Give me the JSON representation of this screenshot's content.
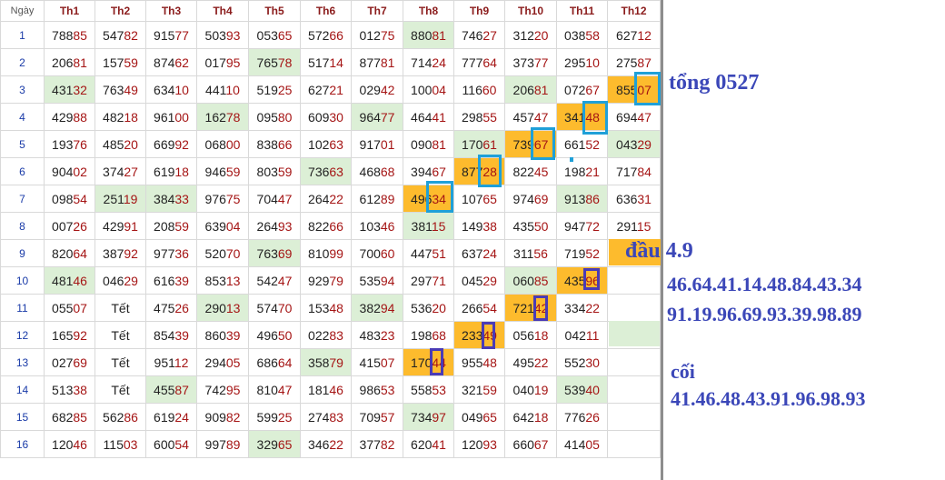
{
  "header": {
    "day_label": "Ngày",
    "months": [
      "Th1",
      "Th2",
      "Th3",
      "Th4",
      "Th5",
      "Th6",
      "Th7",
      "Th8",
      "Th9",
      "Th10",
      "Th11",
      "Th12"
    ]
  },
  "colors": {
    "highlight_green": "#dcefd6",
    "highlight_orange": "#fdbb2d",
    "box_cyan": "#1fa0d8",
    "box_purple": "#4a3bb5",
    "note_text": "#3b47b8"
  },
  "rows": [
    {
      "day": "1",
      "values": [
        "78885",
        "54782",
        "91577",
        "50393",
        "05365",
        "57266",
        "01275",
        "88081",
        "74627",
        "31220",
        "03858",
        "62712"
      ]
    },
    {
      "day": "2",
      "values": [
        "20681",
        "15759",
        "87462",
        "01795",
        "76578",
        "51714",
        "87781",
        "71424",
        "77764",
        "37377",
        "29510",
        "27587"
      ]
    },
    {
      "day": "3",
      "values": [
        "43132",
        "76349",
        "63410",
        "44110",
        "51925",
        "62721",
        "02942",
        "10004",
        "11660",
        "20681",
        "07267",
        "85507"
      ]
    },
    {
      "day": "4",
      "values": [
        "42988",
        "48218",
        "96100",
        "16278",
        "09580",
        "60930",
        "96477",
        "46441",
        "29855",
        "45747",
        "34148",
        "69447"
      ]
    },
    {
      "day": "5",
      "values": [
        "19376",
        "48520",
        "66992",
        "06800",
        "83866",
        "10263",
        "91701",
        "09081",
        "17061",
        "73967",
        "66152",
        "04329"
      ]
    },
    {
      "day": "6",
      "values": [
        "90402",
        "37427",
        "61918",
        "94659",
        "80359",
        "73663",
        "46868",
        "39467",
        "87728",
        "82245",
        "19821",
        "71784"
      ]
    },
    {
      "day": "7",
      "values": [
        "09854",
        "25119",
        "38433",
        "97675",
        "70447",
        "26422",
        "61289",
        "49634",
        "10765",
        "97469",
        "91386",
        "63631"
      ]
    },
    {
      "day": "8",
      "values": [
        "00726",
        "42991",
        "20859",
        "63904",
        "26493",
        "82266",
        "10346",
        "38115",
        "14938",
        "43550",
        "94772",
        "29115"
      ]
    },
    {
      "day": "9",
      "values": [
        "82064",
        "38792",
        "97736",
        "52070",
        "76369",
        "81099",
        "70060",
        "44751",
        "63724",
        "31156",
        "71952",
        ""
      ]
    },
    {
      "day": "10",
      "values": [
        "48146",
        "04629",
        "61639",
        "85313",
        "54247",
        "92979",
        "53594",
        "29771",
        "04529",
        "06085",
        "43596",
        ""
      ]
    },
    {
      "day": "11",
      "values": [
        "05507",
        "Tết",
        "47526",
        "29013",
        "57470",
        "15348",
        "38294",
        "53620",
        "26654",
        "72142",
        "33422",
        ""
      ]
    },
    {
      "day": "12",
      "values": [
        "16592",
        "Tết",
        "85439",
        "86039",
        "49650",
        "02283",
        "48323",
        "19868",
        "23349",
        "05618",
        "04211",
        ""
      ]
    },
    {
      "day": "13",
      "values": [
        "02769",
        "Tết",
        "95112",
        "29405",
        "68664",
        "35879",
        "41507",
        "17044",
        "95548",
        "49522",
        "55230",
        ""
      ]
    },
    {
      "day": "14",
      "values": [
        "51338",
        "Tết",
        "45587",
        "74295",
        "81047",
        "18146",
        "98653",
        "55853",
        "32159",
        "04019",
        "53940",
        ""
      ]
    },
    {
      "day": "15",
      "values": [
        "68285",
        "56286",
        "61924",
        "90982",
        "59925",
        "27483",
        "70957",
        "73497",
        "04965",
        "64218",
        "77626",
        ""
      ]
    },
    {
      "day": "16",
      "values": [
        "12046",
        "11503",
        "60054",
        "99789",
        "32965",
        "34622",
        "37782",
        "62041",
        "12093",
        "66067",
        "41405",
        ""
      ]
    }
  ],
  "notes": {
    "tong": "tổng 0527",
    "dau": "đầu 4.9",
    "line1": "46.64.41.14.48.84.43.34",
    "line2": "91.19.96.69.93.39.98.89",
    "coi": "cối",
    "line3": "41.46.48.43.91.96.98.93"
  }
}
